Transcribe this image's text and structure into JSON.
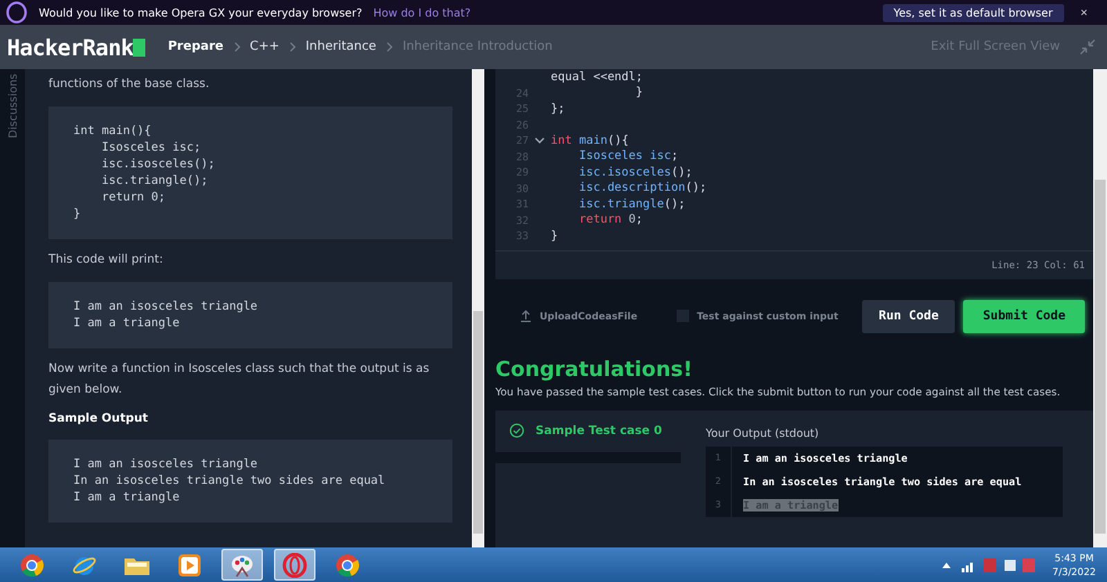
{
  "banner": {
    "message": "Would you like to make Opera GX your everyday browser?",
    "link": "How do I do that?",
    "button": "Yes, set it as default browser",
    "close": "×"
  },
  "header": {
    "logo": "HackerRank",
    "breadcrumbs": [
      {
        "label": "Prepare",
        "current": false
      },
      {
        "label": "C++",
        "current": false
      },
      {
        "label": "Inheritance",
        "current": false
      },
      {
        "label": "Inheritance Introduction",
        "current": true
      }
    ],
    "exit": "Exit Full Screen View"
  },
  "side_tab": "Discussions",
  "problem": [
    {
      "kind": "text",
      "text": "functions of the base class."
    },
    {
      "kind": "code",
      "lines": [
        "int main(){",
        "    Isosceles isc;",
        "    isc.isosceles();",
        "    isc.triangle();",
        "    return 0;",
        "}"
      ]
    },
    {
      "kind": "text",
      "text": "This code will print:"
    },
    {
      "kind": "code",
      "lines": [
        "I am an isosceles triangle",
        "I am a triangle"
      ]
    },
    {
      "kind": "text",
      "text": "Now write a function in Isosceles class such that the output is as given below."
    },
    {
      "kind": "heading",
      "text": "Sample Output"
    },
    {
      "kind": "code",
      "lines": [
        "I am an isosceles triangle",
        "In an isosceles triangle two sides are equal",
        "I am a triangle"
      ]
    }
  ],
  "editor": {
    "lines": [
      {
        "foldable": false,
        "tokens": [
          {
            "kind": "plain",
            "text": "equal <<endl;"
          }
        ]
      },
      {
        "num": "24",
        "foldable": false,
        "tokens": [
          {
            "kind": "plain",
            "text": "            }"
          }
        ]
      },
      {
        "num": "25",
        "foldable": false,
        "tokens": [
          {
            "kind": "plain",
            "text": "};"
          }
        ]
      },
      {
        "num": "26",
        "foldable": false
      },
      {
        "num": "27",
        "foldable": true,
        "tokens": [
          {
            "kind": "keyword",
            "text": "int "
          },
          {
            "kind": "func",
            "text": "main"
          },
          {
            "kind": "plain",
            "text": "(){"
          }
        ]
      },
      {
        "num": "28",
        "foldable": false,
        "tokens": [
          {
            "kind": "func",
            "text": "    Isosceles isc"
          },
          {
            "kind": "plain",
            "text": ";"
          }
        ]
      },
      {
        "num": "29",
        "foldable": false,
        "tokens": [
          {
            "kind": "func",
            "text": "    isc.isosceles"
          },
          {
            "kind": "plain",
            "text": "();"
          }
        ]
      },
      {
        "num": "30",
        "foldable": false,
        "tokens": [
          {
            "kind": "func",
            "text": "    isc.description"
          },
          {
            "kind": "plain",
            "text": "();"
          }
        ]
      },
      {
        "num": "31",
        "foldable": false,
        "tokens": [
          {
            "kind": "func",
            "text": "    isc.triangle"
          },
          {
            "kind": "plain",
            "text": "();"
          }
        ]
      },
      {
        "num": "32",
        "foldable": false,
        "tokens": [
          {
            "kind": "keyword",
            "text": "    return "
          },
          {
            "kind": "number",
            "text": "0"
          },
          {
            "kind": "plain",
            "text": ";"
          }
        ]
      },
      {
        "num": "33",
        "foldable": false,
        "tokens": [
          {
            "kind": "plain",
            "text": "}"
          }
        ]
      }
    ],
    "position": "Line: 23 Col: 61"
  },
  "actions": {
    "upload": "UploadCodeasFile",
    "custom_input": {
      "label": "Test against custom input",
      "checked": false
    },
    "run": "Run Code",
    "submit": "Submit Code"
  },
  "result": {
    "title": "Congratulations!",
    "message": "You have passed the sample test cases. Click the submit button to run your code against all the test cases.",
    "test_case": "Sample Test case 0",
    "output_label": "Your Output (stdout)",
    "output": [
      {
        "num": "1",
        "text": "I am an isosceles triangle",
        "highlighted": false
      },
      {
        "num": "2",
        "text": "In an isosceles triangle two sides are equal",
        "highlighted": false
      },
      {
        "num": "3",
        "text": "I am a triangle",
        "highlighted": true
      }
    ]
  },
  "taskbar": {
    "apps": [
      {
        "kind": "chrome",
        "selected": false
      },
      {
        "kind": "ie",
        "selected": false
      },
      {
        "kind": "folder",
        "selected": false
      },
      {
        "kind": "media",
        "selected": false
      },
      {
        "kind": "paint",
        "selected": true
      },
      {
        "kind": "opera",
        "selected": true
      },
      {
        "kind": "chrome",
        "selected": false
      }
    ],
    "time": "5:43 PM",
    "date": "7/3/2022"
  }
}
